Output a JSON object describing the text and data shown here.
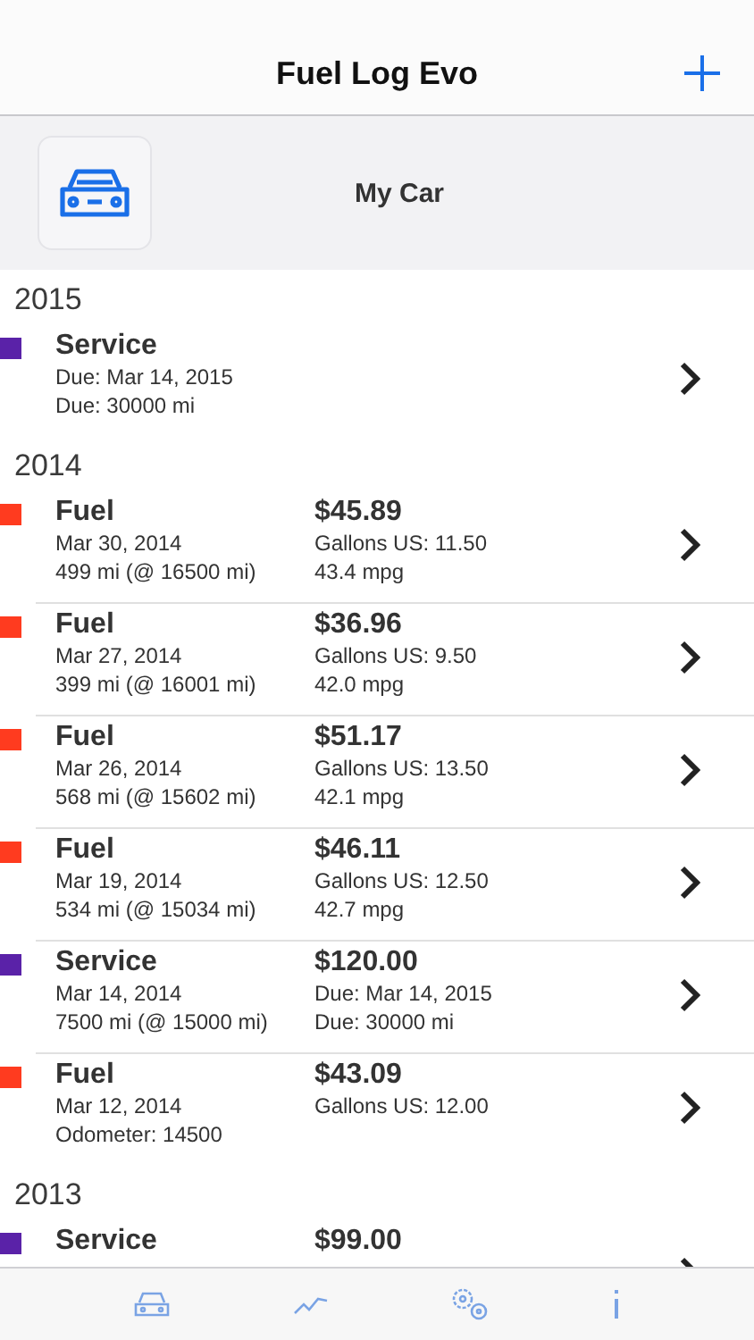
{
  "nav": {
    "title": "Fuel Log Evo"
  },
  "vehicle": {
    "name": "My Car"
  },
  "sections": [
    {
      "year": "2015",
      "entries": [
        {
          "color": "#5a22a8",
          "title": "Service",
          "lines": [
            "Due: Mar 14, 2015",
            "Due: 30000 mi"
          ]
        }
      ]
    },
    {
      "year": "2014",
      "entries": [
        {
          "color": "#ff3b1f",
          "title": "Fuel",
          "lines": [
            "Mar 30, 2014",
            "499 mi (@ 16500 mi)"
          ],
          "amount": "$45.89",
          "details": [
            "Gallons US: 11.50",
            "43.4 mpg"
          ]
        },
        {
          "color": "#ff3b1f",
          "title": "Fuel",
          "lines": [
            "Mar 27, 2014",
            "399 mi (@ 16001 mi)"
          ],
          "amount": "$36.96",
          "details": [
            "Gallons US: 9.50",
            "42.0 mpg"
          ]
        },
        {
          "color": "#ff3b1f",
          "title": "Fuel",
          "lines": [
            "Mar 26, 2014",
            "568 mi (@ 15602 mi)"
          ],
          "amount": "$51.17",
          "details": [
            "Gallons US: 13.50",
            "42.1 mpg"
          ]
        },
        {
          "color": "#ff3b1f",
          "title": "Fuel",
          "lines": [
            "Mar 19, 2014",
            "534 mi (@ 15034 mi)"
          ],
          "amount": "$46.11",
          "details": [
            "Gallons US: 12.50",
            "42.7 mpg"
          ]
        },
        {
          "color": "#5a22a8",
          "title": "Service",
          "lines": [
            "Mar 14, 2014",
            "7500 mi (@ 15000 mi)"
          ],
          "amount": "$120.00",
          "details": [
            "Due: Mar 14, 2015",
            "Due: 30000 mi"
          ]
        },
        {
          "color": "#ff3b1f",
          "title": "Fuel",
          "lines": [
            "Mar 12, 2014",
            "Odometer: 14500"
          ],
          "amount": "$43.09",
          "details": [
            "Gallons US: 12.00"
          ]
        }
      ]
    },
    {
      "year": "2013",
      "entries": [
        {
          "color": "#5a22a8",
          "title": "Service",
          "amount": "$99.00"
        }
      ]
    }
  ],
  "tabs": [
    {
      "kind": "vehicles",
      "selected": false
    },
    {
      "kind": "charts",
      "selected": false
    },
    {
      "kind": "settings",
      "selected": false
    },
    {
      "kind": "info",
      "selected": false
    }
  ]
}
